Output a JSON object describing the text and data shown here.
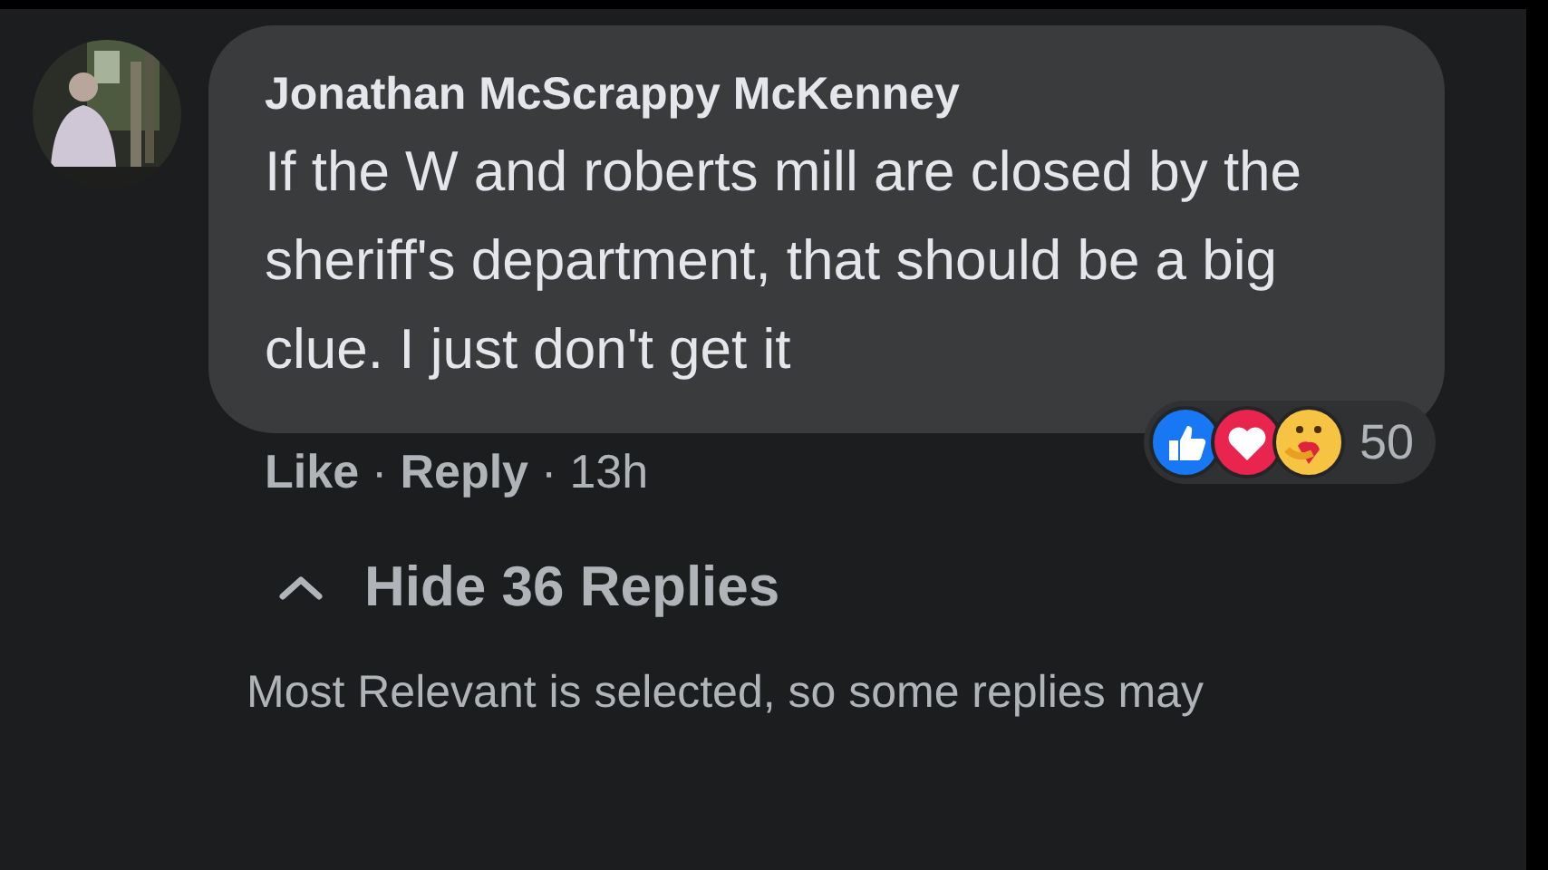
{
  "comment": {
    "author": "Jonathan McScrappy McKenney",
    "text": "If the W and roberts mill are closed by the sheriff's department, that should be a big clue. I just don't get it",
    "reactions": [
      {
        "kind": "like"
      },
      {
        "kind": "love"
      },
      {
        "kind": "care"
      }
    ],
    "reaction_count": "50",
    "actions": [
      {
        "label": "Like"
      },
      {
        "label": "Reply"
      }
    ],
    "separator": "·",
    "time": "13h"
  },
  "replies_toggle": {
    "label": "Hide 36 Replies",
    "expanded": true
  },
  "filter_notice": "Most Relevant is selected, so some replies may"
}
